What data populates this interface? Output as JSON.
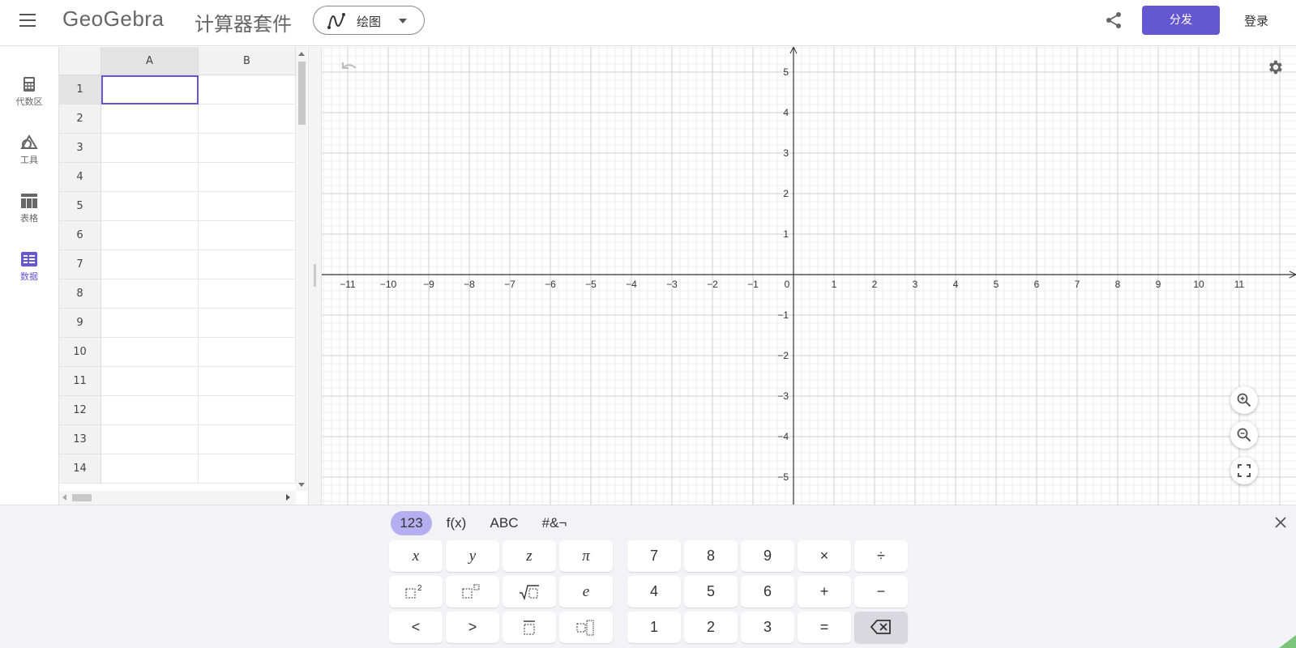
{
  "header": {
    "logo": "GeoGebra",
    "suite_title": "计算器套件",
    "app_picker_label": "绘图",
    "publish_label": "分发",
    "login_label": "登录"
  },
  "sidenav": {
    "items": [
      {
        "label": "代数区",
        "icon": "calculator-icon"
      },
      {
        "label": "工具",
        "icon": "tools-icon"
      },
      {
        "label": "表格",
        "icon": "table-icon"
      },
      {
        "label": "数据",
        "icon": "data-icon",
        "active": true
      }
    ]
  },
  "spreadsheet": {
    "columns": [
      "A",
      "B"
    ],
    "rows": [
      "1",
      "2",
      "3",
      "4",
      "5",
      "6",
      "7",
      "8",
      "9",
      "10",
      "11",
      "12",
      "13",
      "14"
    ],
    "active_cell": "A1"
  },
  "graphics": {
    "x_ticks": [
      "−11",
      "−10",
      "−9",
      "−8",
      "−7",
      "−6",
      "−5",
      "−4",
      "−3",
      "−2",
      "−1",
      "0",
      "1",
      "2",
      "3",
      "4",
      "5",
      "6",
      "7",
      "8",
      "9",
      "10",
      "11"
    ],
    "y_ticks_pos": [
      "5",
      "4",
      "3",
      "2",
      "1"
    ],
    "y_ticks_neg": [
      "−1",
      "−2",
      "−3",
      "−4",
      "−5"
    ],
    "accent_color": "#6557d2"
  },
  "keyboard": {
    "tabs": [
      "123",
      "f(x)",
      "ABC",
      "#&¬"
    ],
    "active_tab": "123",
    "row1_left": [
      "x",
      "y",
      "z",
      "π"
    ],
    "row2_left_last": "e",
    "row3_left": [
      "<",
      ">"
    ],
    "row1_right": [
      "7",
      "8",
      "9",
      "×",
      "÷"
    ],
    "row2_right": [
      "4",
      "5",
      "6",
      "+",
      "−"
    ],
    "row3_right": [
      "1",
      "2",
      "3",
      "="
    ]
  }
}
